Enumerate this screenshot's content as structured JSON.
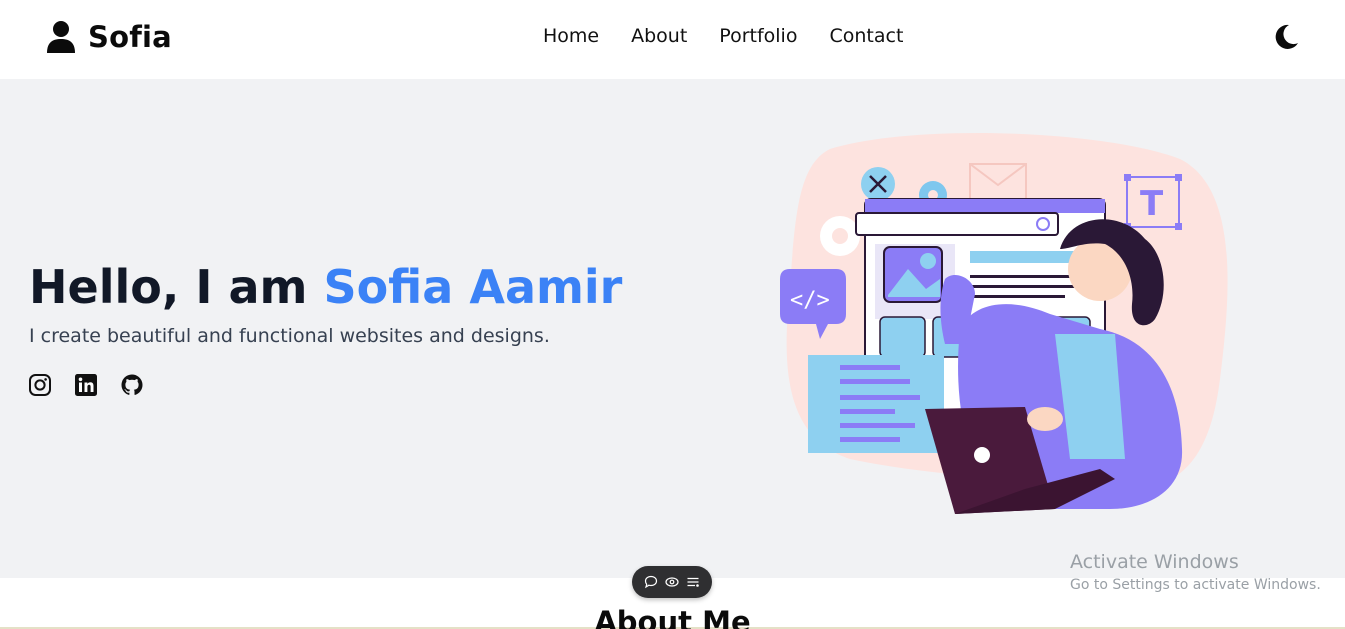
{
  "header": {
    "brand": "Sofia",
    "nav": [
      "Home",
      "About",
      "Portfolio",
      "Contact"
    ]
  },
  "hero": {
    "title_prefix": "Hello, I am ",
    "title_name": "Sofia Aamir",
    "subtitle": "I create beautiful and functional websites and designs.",
    "socials": [
      "instagram-icon",
      "linkedin-icon",
      "github-icon"
    ]
  },
  "about": {
    "heading": "About Me"
  },
  "watermark": {
    "line1": "Activate Windows",
    "line2": "Go to Settings to activate Windows."
  },
  "colors": {
    "accent": "#3b82f6",
    "hero_bg": "#f1f2f4",
    "illustration_purple": "#8b7cf6"
  }
}
